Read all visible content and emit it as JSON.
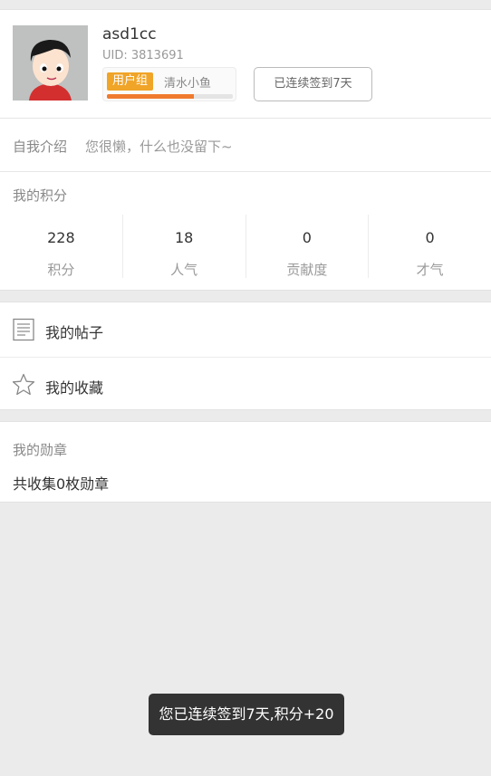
{
  "profile": {
    "username": "asd1cc",
    "uid": "UID: 3813691",
    "group_tag": "用户组",
    "group_name": "清水小鱼",
    "group_progress": 0.69,
    "signin_label": "已连续签到7天"
  },
  "intro": {
    "label": "自我介绍",
    "text": "您很懒，什么也没留下~"
  },
  "points": {
    "title": "我的积分",
    "items": [
      {
        "value": "228",
        "label": "积分"
      },
      {
        "value": "18",
        "label": "人气"
      },
      {
        "value": "0",
        "label": "贡献度"
      },
      {
        "value": "0",
        "label": "才气"
      }
    ]
  },
  "menu": {
    "items": [
      {
        "label": "我的帖子",
        "icon": "document-icon"
      },
      {
        "label": "我的收藏",
        "icon": "star-icon"
      }
    ]
  },
  "medals": {
    "title": "我的勋章",
    "count_text": "共收集0枚勋章"
  },
  "toast": {
    "text": "您已连续签到7天,积分+20"
  },
  "colors": {
    "accent_orange": "#ef7a2e",
    "tag_orange": "#f0a428",
    "background": "#ebebeb",
    "toast_bg": "#333333"
  }
}
